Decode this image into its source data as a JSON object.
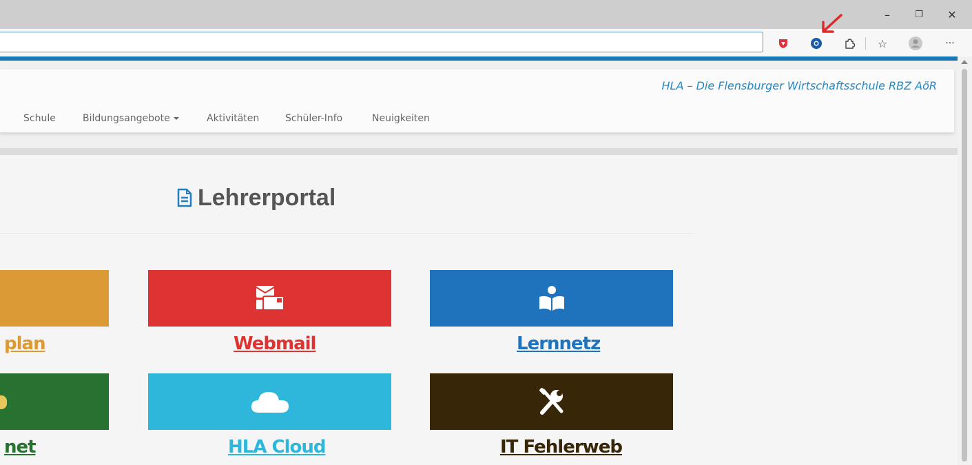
{
  "browser": {
    "minimize_glyph": "–",
    "restore_glyph": "❐",
    "close_glyph": "✕",
    "more_glyph": "···",
    "favorites_glyph": "☆",
    "extensions_glyph": "⌘"
  },
  "site": {
    "brand": "HLA – Die Flensburger Wirtschaftsschule RBZ AöR",
    "nav": [
      "Schule",
      "Bildungsangebote",
      "Aktivitäten",
      "Schüler-Info",
      "Neuigkeiten"
    ]
  },
  "portal": {
    "title": "Lehrerportal",
    "tiles": [
      {
        "label": "plan",
        "color": "#dc9a36",
        "icon": "calendar-icon"
      },
      {
        "label": "Webmail",
        "color": "#dd3333",
        "icon": "envelope-icon"
      },
      {
        "label": "Lernnetz",
        "color": "#1f73bd",
        "icon": "reader-icon"
      },
      {
        "label": "net",
        "color": "#277230",
        "icon": "puzzle-icon"
      },
      {
        "label": "HLA Cloud",
        "color": "#2eb7da",
        "icon": "cloud-icon"
      },
      {
        "label": "IT Fehlerweb",
        "color": "#382608",
        "icon": "tools-icon"
      }
    ]
  },
  "colors": {
    "accent": "#1777b8",
    "brand_text": "#2388c4",
    "arrow": "#e02a2a"
  }
}
